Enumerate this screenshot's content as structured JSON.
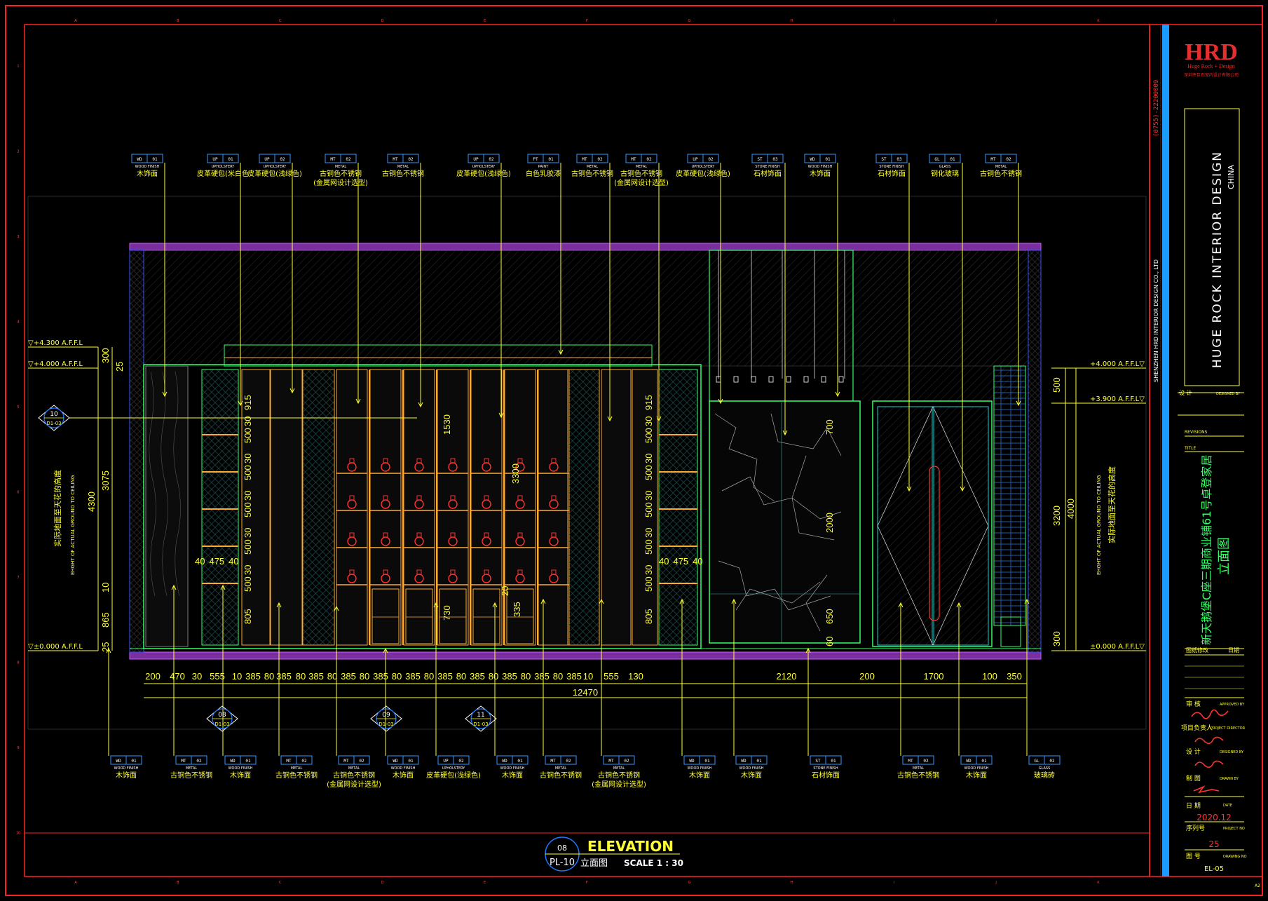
{
  "sheet": {
    "phone": "(0755)-22200009",
    "company_en": "SHENZHEN HRD INTERIOR DESIGN CO., LTD",
    "logo_text": "HRD",
    "logo_sub": "Huge Rock + Design",
    "logo_cn": "深圳市巨石室内设计有限公司",
    "brand": "HUGE ROCK INTERIOR DESIGN",
    "brand_country": "CHINA",
    "designer_label": "设 计",
    "designer_en": "DESIGNED BY",
    "revisions_label": "REVISIONS",
    "title_label": "TITLE",
    "project_title": "新天鹅堡C座三期商业铺61号卓登家居",
    "drawing_title": "立面图",
    "revision_col_a": "图纸修改",
    "revision_col_b": "日期",
    "review_label": "审 核",
    "review_en": "APPROVED BY",
    "pm_label": "项目负责人",
    "pm_en": "PROJECT DIRECTOR",
    "design_label": "设 计",
    "design_en": "DESIGNED BY",
    "draw_label": "制 图",
    "draw_en": "DRAWN BY",
    "date_label": "日 期",
    "date_en": "DATE",
    "date_value": "2020.12",
    "seq_label": "序列号",
    "seq_en": "PROJECT NO",
    "seq_value": "25",
    "no_label": "图 号",
    "no_en": "DRAWING NO",
    "no_value": "EL-05",
    "corner": "A2"
  },
  "footer": {
    "callout_num": "08",
    "callout_ref": "PL-10",
    "title_en": "ELEVATION",
    "title_cn": "立面图",
    "scale": "SCALE 1 : 30"
  },
  "top_tags": [
    {
      "code": "WD",
      "num": "01",
      "cat": "WOOD FINISH",
      "name": "木饰面"
    },
    {
      "code": "UP",
      "num": "01",
      "cat": "UPHOLSTERY",
      "name": "皮革硬包(米白色"
    },
    {
      "code": "UP",
      "num": "02",
      "cat": "UPHOLSTERY",
      "name": "皮革硬包(浅绿色)"
    },
    {
      "code": "MT",
      "num": "02",
      "cat": "METAL",
      "name": "古铜色不锈钢",
      "name2": "(金属网设计选型)"
    },
    {
      "code": "MT",
      "num": "02",
      "cat": "METAL",
      "name": "古铜色不锈钢"
    },
    {
      "code": "UP",
      "num": "02",
      "cat": "UPHOLSTERY",
      "name": "皮革硬包(浅绿色)"
    },
    {
      "code": "PT",
      "num": "01",
      "cat": "PAINT",
      "name": "白色乳胶漆"
    },
    {
      "code": "MT",
      "num": "02",
      "cat": "METAL",
      "name": "古铜色不锈钢"
    },
    {
      "code": "MT",
      "num": "02",
      "cat": "METAL",
      "name": "古铜色不锈钢",
      "name2": "(金属网设计选型)"
    },
    {
      "code": "UP",
      "num": "02",
      "cat": "UPHOLSTERY",
      "name": "皮革硬包(浅绿色)"
    },
    {
      "code": "ST",
      "num": "03",
      "cat": "STONE FINISH",
      "name": "石材饰面"
    },
    {
      "code": "WD",
      "num": "01",
      "cat": "WOOD FINISH",
      "name": "木饰面"
    },
    {
      "code": "ST",
      "num": "03",
      "cat": "STONE FINISH",
      "name": "石材饰面"
    },
    {
      "code": "GL",
      "num": "01",
      "cat": "GLASS",
      "name": "钢化玻璃"
    },
    {
      "code": "MT",
      "num": "02",
      "cat": "METAL",
      "name": "古铜色不锈钢"
    }
  ],
  "bottom_tags": [
    {
      "code": "WD",
      "num": "01",
      "cat": "WOOD FINISH",
      "name": "木饰面"
    },
    {
      "code": "MT",
      "num": "02",
      "cat": "METAL",
      "name": "古铜色不锈钢"
    },
    {
      "code": "WD",
      "num": "01",
      "cat": "WOOD FINISH",
      "name": "木饰面"
    },
    {
      "code": "MT",
      "num": "02",
      "cat": "METAL",
      "name": "古铜色不锈钢"
    },
    {
      "code": "MT",
      "num": "02",
      "cat": "METAL",
      "name": "古铜色不锈钢",
      "name2": "(金属网设计选型)"
    },
    {
      "code": "WD",
      "num": "01",
      "cat": "WOOD FINISH",
      "name": "木饰面"
    },
    {
      "code": "UP",
      "num": "02",
      "cat": "UPHOLSTERY",
      "name": "皮革硬包(浅绿色)"
    },
    {
      "code": "WD",
      "num": "01",
      "cat": "WOOD FINISH",
      "name": "木饰面"
    },
    {
      "code": "MT",
      "num": "02",
      "cat": "METAL",
      "name": "古铜色不锈钢"
    },
    {
      "code": "MT",
      "num": "02",
      "cat": "METAL",
      "name": "古铜色不锈钢",
      "name2": "(金属网设计选型)"
    },
    {
      "code": "WD",
      "num": "01",
      "cat": "WOOD FINISH",
      "name": "木饰面"
    },
    {
      "code": "WD",
      "num": "01",
      "cat": "WOOD FINISH",
      "name": "木饰面"
    },
    {
      "code": "ST",
      "num": "01",
      "cat": "STONE FINISH",
      "name": "石材饰面"
    },
    {
      "code": "MT",
      "num": "02",
      "cat": "METAL",
      "name": "古铜色不锈钢"
    },
    {
      "code": "WD",
      "num": "01",
      "cat": "WOOD FINISH",
      "name": "木饰面"
    },
    {
      "code": "GL",
      "num": "02",
      "cat": "GLASS",
      "name": "玻璃砖"
    }
  ],
  "levels": {
    "left_top": "▽+4.300 A.F.F.L",
    "left_mid": "▽+4.000 A.F.F.L",
    "left_bottom": "▽±0.000 A.F.F.L",
    "right_top": "+4.000 A.F.F.L▽",
    "right_mid": "+3.900 A.F.F.L▽",
    "right_bottom": "±0.000 A.F.F.L▽"
  },
  "vertical_notes": {
    "left_cn": "实际地面至天花的高度",
    "left_en": "EHGHT OF ACTUAL GROUND TO CEILING",
    "right_cn": "实际地面至天花的高度",
    "right_en": "EHGHT OF ACTUAL GROUND TO CEILING"
  },
  "left_dims": {
    "d1": "300",
    "d2": "25",
    "d3": "3075",
    "d4": "4300",
    "d5": "10",
    "d6": "865",
    "d7": "25"
  },
  "right_dims": {
    "d1": "500",
    "d2": "3200",
    "d3": "4000",
    "d4": "300"
  },
  "inner_dims": {
    "a": "915",
    "b": "30",
    "c": "500",
    "d": "805",
    "e": "40",
    "f": "475",
    "g": "1530",
    "h": "3300",
    "i": "730",
    "j": "150",
    "k": "335",
    "l": "700",
    "m": "2000",
    "n": "650",
    "o": "60",
    "p": "20"
  },
  "bottom_dims": [
    "200",
    "470",
    "30",
    "555",
    "10",
    "385",
    "80",
    "385",
    "80",
    "385",
    "80",
    "385",
    "80",
    "385",
    "80",
    "385",
    "80",
    "385",
    "80",
    "385",
    "80",
    "385",
    "80",
    "385",
    "80",
    "385",
    "10",
    "555",
    "130",
    "2120",
    "200",
    "1700",
    "100",
    "350"
  ],
  "total_dim": "12470",
  "section_callouts": [
    {
      "num": "08",
      "ref": "D1-03"
    },
    {
      "num": "09",
      "ref": "D1-03"
    },
    {
      "num": "11",
      "ref": "D1-03"
    },
    {
      "num": "10",
      "ref": "D1-03"
    }
  ],
  "grid_letters": [
    "A",
    "B",
    "C",
    "D",
    "E",
    "F",
    "G",
    "H",
    "I",
    "J",
    "K"
  ],
  "grid_numbers": [
    "1",
    "2",
    "3",
    "4",
    "5",
    "6",
    "7",
    "8",
    "9",
    "10"
  ]
}
